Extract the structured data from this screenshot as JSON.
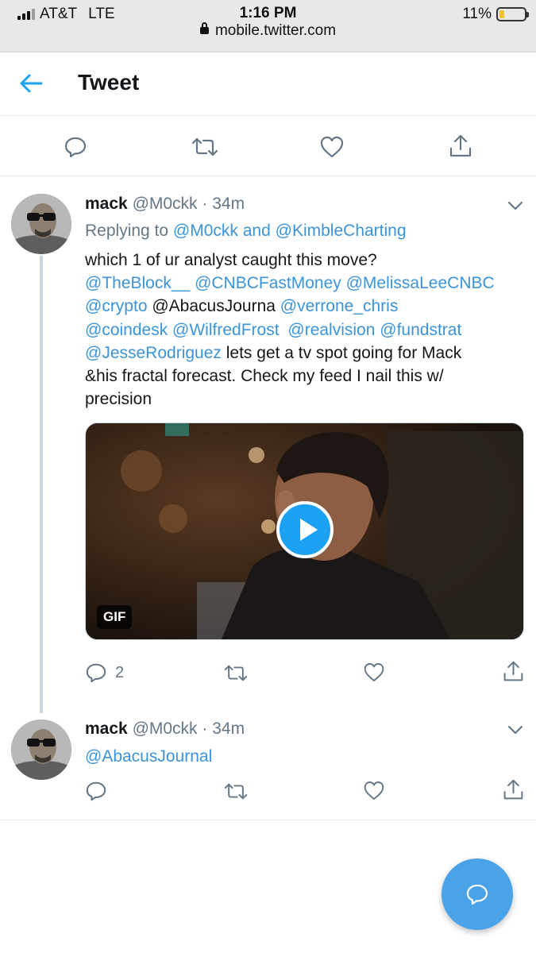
{
  "status_bar": {
    "carrier": "AT&T",
    "network": "LTE",
    "time": "1:16 PM",
    "url": "mobile.twitter.com",
    "battery": "11%"
  },
  "header": {
    "title": "Tweet",
    "back_icon": "arrow-left-icon"
  },
  "main_tweet_actions": {
    "icons": [
      "reply-icon",
      "retweet-icon",
      "like-icon",
      "share-icon"
    ]
  },
  "tweets": [
    {
      "name": "mack",
      "handle": "@M0ckk",
      "time": "· 34m",
      "replying_prefix": "Replying to",
      "replying_to_1": "@M0ckk",
      "replying_and": "and",
      "replying_to_2": "@KimbleCharting",
      "text_line1": "which 1 of ur analyst caught this move?",
      "mention_theblock": "@TheBlock__",
      "mention_cnbc": "@CNBCFastMoney",
      "mention_melissa": "@MelissaLeeCNBC",
      "mention_crypto": "@crypto",
      "text_abacus": "@AbacusJourna",
      "mention_verrone": "@verrone_chris",
      "mention_coindesk": "@coindesk",
      "mention_wilfred": "@WilfredFrost",
      "mention_realvision": "@realvision",
      "mention_fundstrat": "@fundstrat",
      "mention_jesse": "@JesseRodriguez",
      "text_line6_rest": "lets get a tv spot going for Mack",
      "text_line7": "&his fractal forecast. Check my feed I nail this w/",
      "text_line8": "precision",
      "media_badge": "GIF",
      "reply_count": "2"
    },
    {
      "name": "mack",
      "handle": "@M0ckk",
      "time": "· 34m",
      "text": "@AbacusJournal"
    }
  ],
  "colors": {
    "accent": "#1da1f2",
    "secondary_text": "#657786",
    "border": "#e6ecf0",
    "fab": "#4aa3e8"
  }
}
